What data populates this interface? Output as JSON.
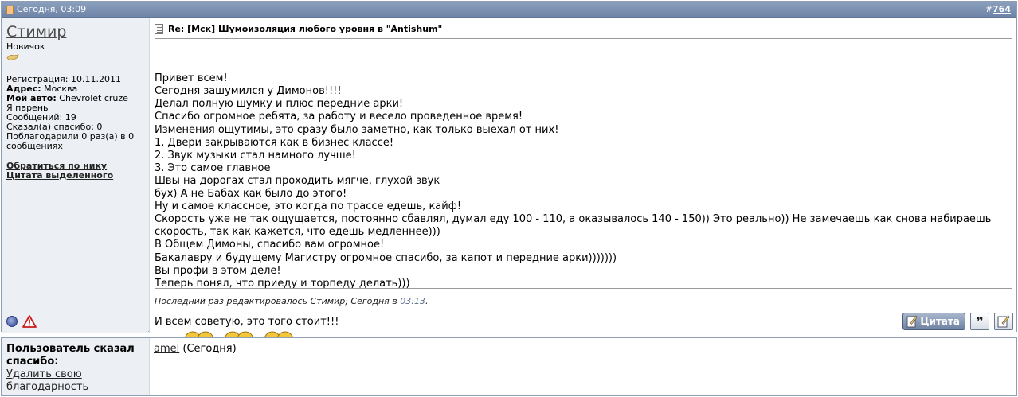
{
  "post": {
    "date": "Сегодня, 03:09",
    "hash": "#",
    "number": "764",
    "title": "Re: [Мск] Шумоизоляция любого уровня в \"Antishum\"",
    "message_lines": [
      "Привет всем!",
      "Сегодня зашумился у Димонов!!!!",
      "Делал полную шумку и плюс передние арки!",
      "Спасибо огромное ребята, за работу и весело проведенное время!",
      "Изменения ощутимы, это сразу было заметно, как только выехал от них!",
      "1. Двери закрываются как в бизнес классе!",
      "2. Звук музыки стал намного лучше!",
      "3. Это самое главное",
      "Швы на дорогах стал проходить мягче, глухой звук",
      "бух) А не Бабах как было до этого!",
      "Ну и самое классное, это когда по трассе едешь, кайф!",
      "Скорость уже не так ощущается, постоянно сбавлял, думал еду 100 - 110, а оказывалось 140 - 150)) Это реально)) Не замечаешь как снова набираешь",
      "скорость, так как кажется, что едешь медленнее)))",
      "В Общем Димоны, спасибо вам огромное!",
      "Бакалавру и будущему Магистру огромное спасибо, за капот и передние арки)))))))",
      "Вы профи в этом деле!",
      "Теперь понял, что приеду и торпеду делать)))"
    ],
    "last_line": "И всем советую, это того стоит!!!",
    "edited_prefix": "Последний раз редактировалось Стимир; Сегодня в ",
    "edited_time": "03:13",
    "edited_suffix": ".",
    "quote_button": "Цитата"
  },
  "user": {
    "name": "Стимир",
    "rank": "Новичок",
    "registration": "Регистрация: 10.11.2011",
    "address_label": "Адрес:",
    "address": "Москва",
    "car_label": "Мой авто:",
    "car": "Chevrolet cruze",
    "gender": "Я парень",
    "posts": "Сообщений: 19",
    "thanks_given": "Сказал(а) спасибо: 0",
    "thanked": "Поблагодарили 0 раз(а) в 0 сообщениях",
    "link_nick": "Обратиться по нику",
    "link_quote_selected": "Цитата выделенного"
  },
  "thanks": {
    "label": "Пользователь сказал спасибо:",
    "remove_link": "Удалить свою благодарность",
    "user": "amel",
    "when": " (Сегодня)"
  },
  "icons": [
    "page-icon",
    "reputation-icon",
    "online-status-icon",
    "report-icon",
    "document-icon",
    "laughing-smiley-icon",
    "pencil-icon",
    "multi-quote-icon",
    "edit-icon"
  ],
  "colors": {
    "header": "#7a8fb0",
    "sidebar": "#eceff3",
    "link": "#222222"
  }
}
